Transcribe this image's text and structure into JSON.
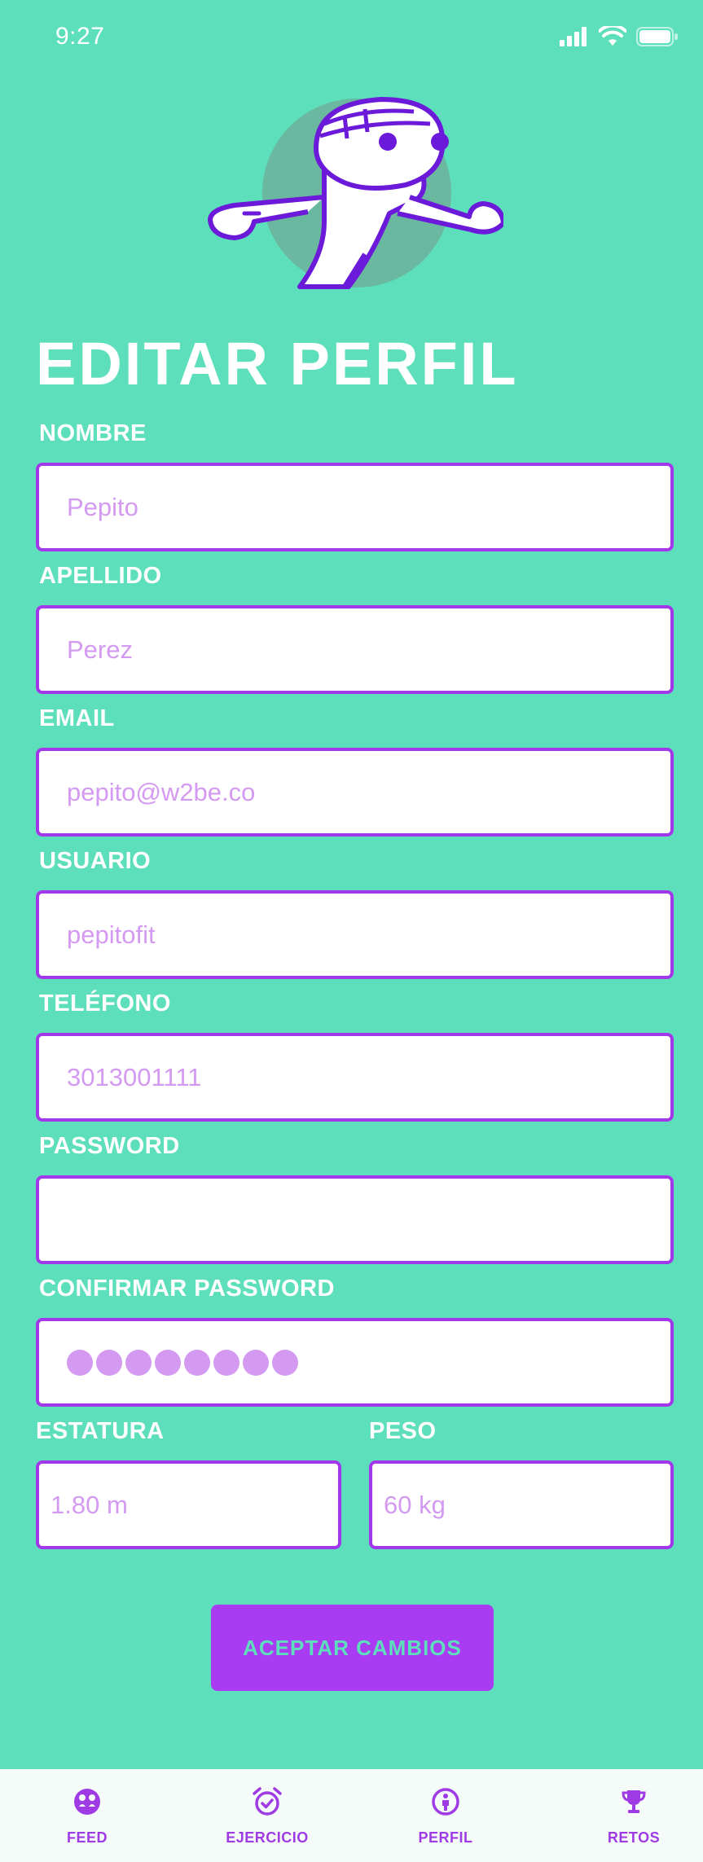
{
  "status_bar": {
    "time": "9:27"
  },
  "header": {
    "title": "EDITAR PERFIL"
  },
  "form": {
    "nombre": {
      "label": "NOMBRE",
      "value": "Pepito"
    },
    "apellido": {
      "label": "APELLIDO",
      "value": "Perez"
    },
    "email": {
      "label": "EMAIL",
      "value": "pepito@w2be.co"
    },
    "usuario": {
      "label": "USUARIO",
      "value": "pepitofit"
    },
    "telefono": {
      "label": "TELÉFONO",
      "value": "3013001111"
    },
    "password": {
      "label": "PASSWORD",
      "value": ""
    },
    "confirm_password": {
      "label": "CONFIRMAR PASSWORD",
      "masked_length": 8
    },
    "estatura": {
      "label": "ESTATURA",
      "value": "1.80 m"
    },
    "peso": {
      "label": "PESO",
      "value": "60 kg"
    }
  },
  "actions": {
    "accept_label": "ACEPTAR CAMBIOS"
  },
  "tab_bar": {
    "items": [
      {
        "label": "FEED",
        "icon": "feed-icon"
      },
      {
        "label": "EJERCICIO",
        "icon": "alarm-check-icon"
      },
      {
        "label": "PERFIL",
        "icon": "person-icon"
      },
      {
        "label": "RETOS",
        "icon": "trophy-icon"
      }
    ]
  },
  "colors": {
    "background": "#5EDFBC",
    "accent": "#A238EA",
    "placeholder_text": "#D49AF1",
    "tab_bar_bg": "#F5FBF9"
  }
}
